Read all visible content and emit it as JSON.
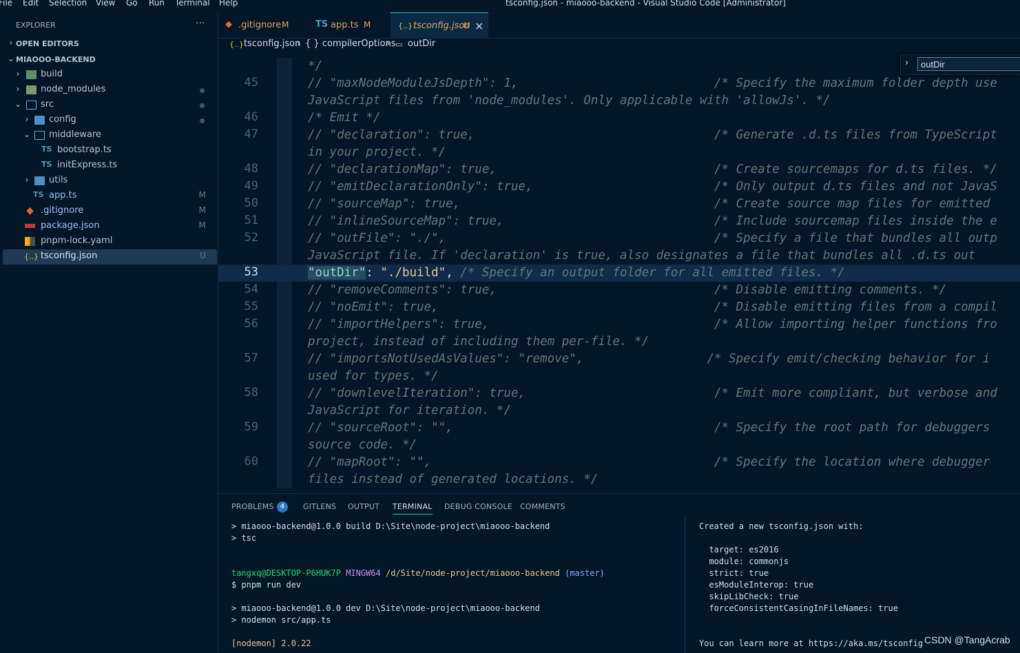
{
  "menu": [
    "File",
    "Edit",
    "Selection",
    "View",
    "Go",
    "Run",
    "Terminal",
    "Help"
  ],
  "window_title": "tsconfig.json - miaooo-backend - Visual Studio Code [Administrator]",
  "sidebar": {
    "title": "EXPLORER",
    "more": "···",
    "open_editors": "OPEN EDITORS",
    "project": "MIAOOO-BACKEND",
    "items": [
      {
        "label": "build",
        "badge": ""
      },
      {
        "label": "node_modules",
        "badge": ""
      },
      {
        "label": "src",
        "badge": ""
      },
      {
        "label": "config",
        "badge": ""
      },
      {
        "label": "middleware",
        "badge": ""
      },
      {
        "label": "bootstrap.ts",
        "badge": ""
      },
      {
        "label": "initExpress.ts",
        "badge": ""
      },
      {
        "label": "utils",
        "badge": ""
      },
      {
        "label": "app.ts",
        "badge": "M"
      },
      {
        "label": ".gitignore",
        "badge": "M"
      },
      {
        "label": "package.json",
        "badge": "M"
      },
      {
        "label": "pnpm-lock.yaml",
        "badge": ""
      },
      {
        "label": "tsconfig.json",
        "badge": "U"
      }
    ]
  },
  "tabs": [
    {
      "label": ".gitignore",
      "status": "M",
      "icon": "git-icon"
    },
    {
      "label": "app.ts",
      "status": "M",
      "icon": "TS"
    },
    {
      "label": "tsconfig.json",
      "status": "U",
      "icon": "{..}",
      "close": "×"
    }
  ],
  "breadcrumb": {
    "icon": "{..}",
    "file": "tsconfig.json",
    "sep": "›",
    "section": "{ } compilerOptions",
    "symbol_icon": "▭",
    "symbol": "outDir"
  },
  "find": {
    "chevron": "›",
    "value": "outDir"
  },
  "editor": {
    "lines": [
      {
        "num": "",
        "text": "*/"
      },
      {
        "num": "45",
        "text": "// \"maxNodeModuleJsDepth\": 1,                           /* Specify the maximum folder depth use"
      },
      {
        "num": "",
        "text": "JavaScript files from 'node_modules'. Only applicable with 'allowJs'. */"
      },
      {
        "num": "46",
        "text": "/* Emit */"
      },
      {
        "num": "47",
        "text": "// \"declaration\": true,                                 /* Generate .d.ts files from TypeScript"
      },
      {
        "num": "",
        "text": "in your project. */"
      },
      {
        "num": "48",
        "text": "// \"declarationMap\": true,                              /* Create sourcemaps for d.ts files. */"
      },
      {
        "num": "49",
        "text": "// \"emitDeclarationOnly\": true,                         /* Only output d.ts files and not JavaS"
      },
      {
        "num": "50",
        "text": "// \"sourceMap\": true,                                   /* Create source map files for emitted "
      },
      {
        "num": "51",
        "text": "// \"inlineSourceMap\": true,                             /* Include sourcemap files inside the e"
      },
      {
        "num": "52",
        "text": "// \"outFile\": \"./\",                                     /* Specify a file that bundles all outp"
      },
      {
        "num": "",
        "text": "JavaScript file. If 'declaration' is true, also designates a file that bundles all .d.ts out"
      },
      {
        "num": "53",
        "key": "\"outDir\"",
        "colon": ": ",
        "value": "\"./build\"",
        "comma": ", ",
        "comment": "/* Specify an output folder for all emitted files. */"
      },
      {
        "num": "54",
        "text": "// \"removeComments\": true,                              /* Disable emitting comments. */"
      },
      {
        "num": "55",
        "text": "// \"noEmit\": true,                                      /* Disable emitting files from a compil"
      },
      {
        "num": "56",
        "text": "// \"importHelpers\": true,                               /* Allow importing helper functions fro"
      },
      {
        "num": "",
        "text": "project, instead of including them per-file. */"
      },
      {
        "num": "57",
        "text": "// \"importsNotUsedAsValues\": \"remove\",                 /* Specify emit/checking behavior for i"
      },
      {
        "num": "",
        "text": "used for types. */"
      },
      {
        "num": "58",
        "text": "// \"downlevelIteration\": true,                          /* Emit more compliant, but verbose and"
      },
      {
        "num": "",
        "text": "JavaScript for iteration. */"
      },
      {
        "num": "59",
        "text": "// \"sourceRoot\": \"\",                                    /* Specify the root path for debuggers "
      },
      {
        "num": "",
        "text": "source code. */"
      },
      {
        "num": "60",
        "text": "// \"mapRoot\": \"\",                                       /* Specify the location where debugger "
      },
      {
        "num": "",
        "text": "files instead of generated locations. */"
      }
    ]
  },
  "panel": {
    "tabs": [
      "PROBLEMS",
      "GITLENS",
      "OUTPUT",
      "TERMINAL",
      "DEBUG CONSOLE",
      "COMMENTS"
    ],
    "problems_count": "4",
    "terminal_left": [
      "> miaooo-backend@1.0.0 build D:\\Site\\node-project\\miaooo-backend",
      "> tsc",
      "",
      "",
      "",
      "$ pnpm run dev",
      "",
      "> miaooo-backend@1.0.0 dev D:\\Site\\node-project\\miaooo-backend",
      "> nodemon src/app.ts",
      "",
      "[nodemon] 2.0.22"
    ],
    "prompt": {
      "user": "tangxq@DESKTOP-P6HUK7P",
      "shell": "MINGW64",
      "path": "/d/Site/node-project/miaooo-backend",
      "branch": "(master)"
    },
    "terminal_right": [
      "Created a new tsconfig.json with:",
      "",
      "  target: es2016",
      "  module: commonjs",
      "  strict: true",
      "  esModuleInterop: true",
      "  skipLibCheck: true",
      "  forceConsistentCasingInFileNames: true",
      "",
      "",
      "You can learn more at https://aka.ms/tsconfig"
    ],
    "watermark": "CSDN @TangAcrab"
  },
  "colors": {
    "accent": "#21c7a8",
    "background": "#011627",
    "modified": "#5f7e97",
    "key": "#7fdbca",
    "string": "#ecc48d",
    "comment": "#637777"
  }
}
